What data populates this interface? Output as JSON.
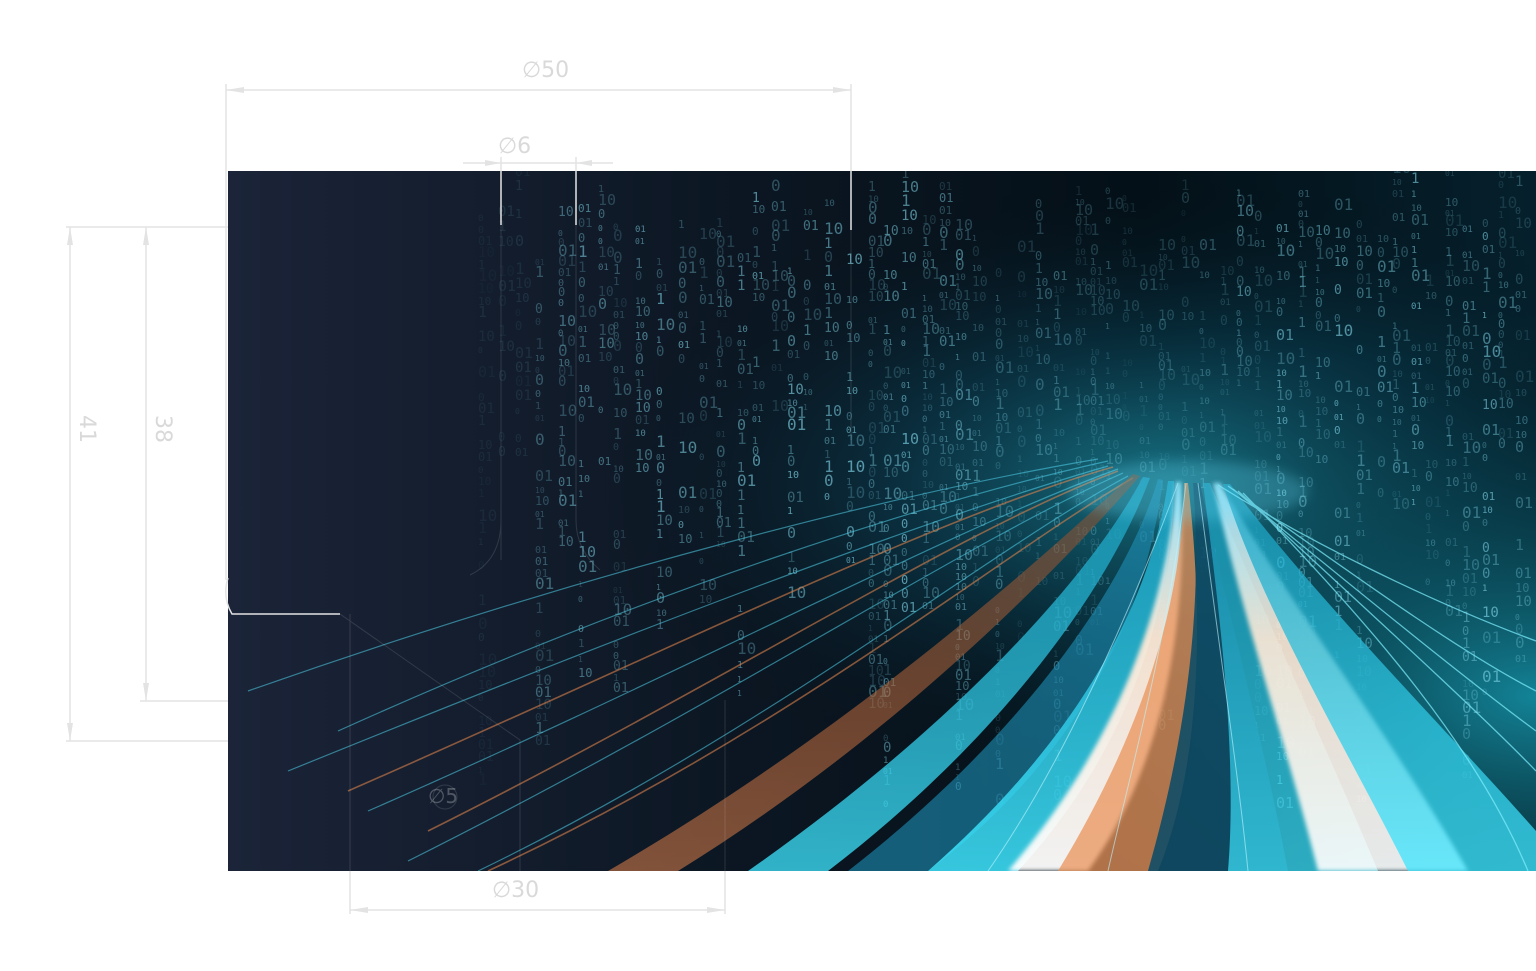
{
  "dimensions": {
    "outer_diameter": "50",
    "inner_diameter": "6",
    "bottom_diameter": "30",
    "height_outer": "41",
    "height_inner": "38",
    "small_diameter": "5"
  },
  "symbols": {
    "diameter": "∅"
  },
  "colors": {
    "hero_dark": "#0b1420",
    "trail_cyan": "#22d6f0",
    "trail_white": "#ffffff",
    "trail_orange": "#e08a4a",
    "binary_code": "#7fd3e6",
    "drawing_line": "#e0e0e0"
  },
  "binary_digits": [
    "0",
    "1",
    "10",
    "01"
  ]
}
